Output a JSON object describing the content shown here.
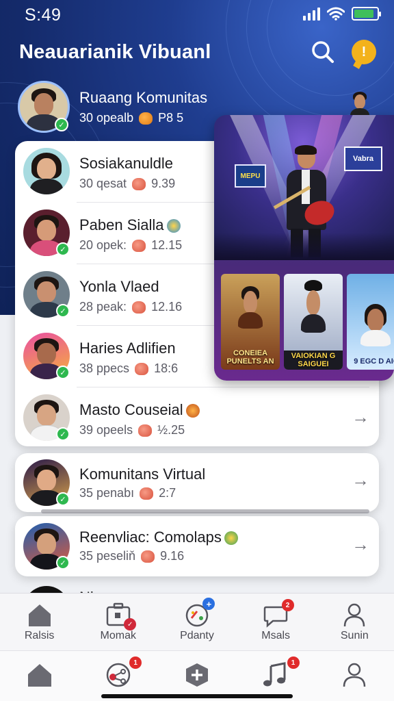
{
  "status_bar": {
    "time": "S:49"
  },
  "header": {
    "title": "Neauarianik Vibuanl",
    "search_icon": "search-icon",
    "notification_icon": "notification-icon",
    "notification_symbol": "!"
  },
  "featured": {
    "name": "Ruaang Komunitas",
    "meta": "30 opealb",
    "stat": "P8 5"
  },
  "list": [
    {
      "name": "Sosiakanuldle",
      "meta": "30 qesat",
      "stat": "9.39",
      "badge": "",
      "arrow": false
    },
    {
      "name": "Paben Sialla",
      "meta": "20 opek:",
      "stat": "12.15",
      "badge": "globe",
      "arrow": false
    },
    {
      "name": "Yonla Vlaed",
      "meta": "28 peak:",
      "stat": "12.16",
      "badge": "",
      "arrow": false
    },
    {
      "name": "Haries Adlifien",
      "meta": "38 ppecs",
      "stat": "18:6",
      "badge": "",
      "arrow": false
    },
    {
      "name": "Masto Couseial",
      "meta": "39 opeels",
      "stat": "½.25",
      "badge": "fire",
      "arrow": true
    }
  ],
  "cards": [
    {
      "name": "Komunitans Virtual",
      "meta": "35 penabı",
      "stat": "2:7",
      "badge": ""
    },
    {
      "name": "Reenvliac: Comolaps",
      "meta": "35 peseliň",
      "stat": "9.16",
      "badge": "globe"
    }
  ],
  "event": {
    "stage_sign_left": "MEPU",
    "stage_sign_right": "Vabra",
    "thumbs": [
      {
        "label": "CONEIEA PUNELTS AN"
      },
      {
        "label": "VAIOKIAN G SAIGUEI"
      },
      {
        "label": "9 EGC D AIC"
      }
    ]
  },
  "peek_row_text": "Ni ...",
  "tabbar_top": [
    {
      "label": "Ralsis",
      "icon": "home-icon",
      "badge": ""
    },
    {
      "label": "Momak",
      "icon": "camera-bag-icon",
      "badge": "check"
    },
    {
      "label": "Pdanty",
      "icon": "mixed-circle-icon",
      "badge": "+"
    },
    {
      "label": "Msals",
      "icon": "chat-bubble-icon",
      "badge": "2"
    },
    {
      "label": "Sunin",
      "icon": "profile-icon",
      "badge": ""
    }
  ],
  "tabbar_bottom": [
    {
      "icon": "home-icon",
      "badge": ""
    },
    {
      "icon": "share-network-icon",
      "badge": "1"
    },
    {
      "icon": "add-box-icon",
      "badge": ""
    },
    {
      "icon": "music-note-icon",
      "badge": "1"
    },
    {
      "icon": "profile-icon",
      "badge": ""
    }
  ],
  "colors": {
    "header_bg": "#142a6a",
    "accent_yellow": "#f3b21c",
    "verified_green": "#2eb84f",
    "badge_red": "#e02b2b"
  }
}
